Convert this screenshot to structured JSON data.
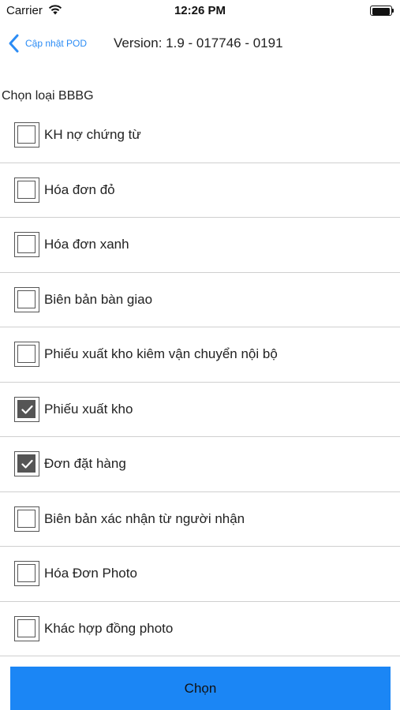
{
  "status_bar": {
    "carrier": "Carrier",
    "time": "12:26 PM"
  },
  "nav": {
    "back_label": "Cập nhật POD",
    "title": "Version: 1.9 - 017746 - 0191"
  },
  "section": {
    "header": "Chọn loại BBBG"
  },
  "options": [
    {
      "label": "KH nợ chứng từ",
      "checked": false
    },
    {
      "label": "Hóa đơn đỏ",
      "checked": false
    },
    {
      "label": "Hóa đơn xanh",
      "checked": false
    },
    {
      "label": "Biên bản bàn giao",
      "checked": false
    },
    {
      "label": "Phiếu xuất kho kiêm vận chuyển nội bộ",
      "checked": false
    },
    {
      "label": "Phiếu xuất kho",
      "checked": true
    },
    {
      "label": "Đơn đặt hàng",
      "checked": true
    },
    {
      "label": "Biên bản xác nhận từ người nhận",
      "checked": false
    },
    {
      "label": "Hóa Đơn Photo",
      "checked": false
    },
    {
      "label": "Khác hợp đồng photo",
      "checked": false
    }
  ],
  "submit": {
    "label": "Chọn"
  },
  "colors": {
    "accent": "#1b86f5",
    "back_link": "#2b8cf5",
    "checkbox": "#555555",
    "separator": "#cfcfcf"
  },
  "icons": [
    "wifi-icon",
    "battery-icon",
    "chevron-left-icon",
    "checkbox-icon",
    "checkmark-icon"
  ]
}
